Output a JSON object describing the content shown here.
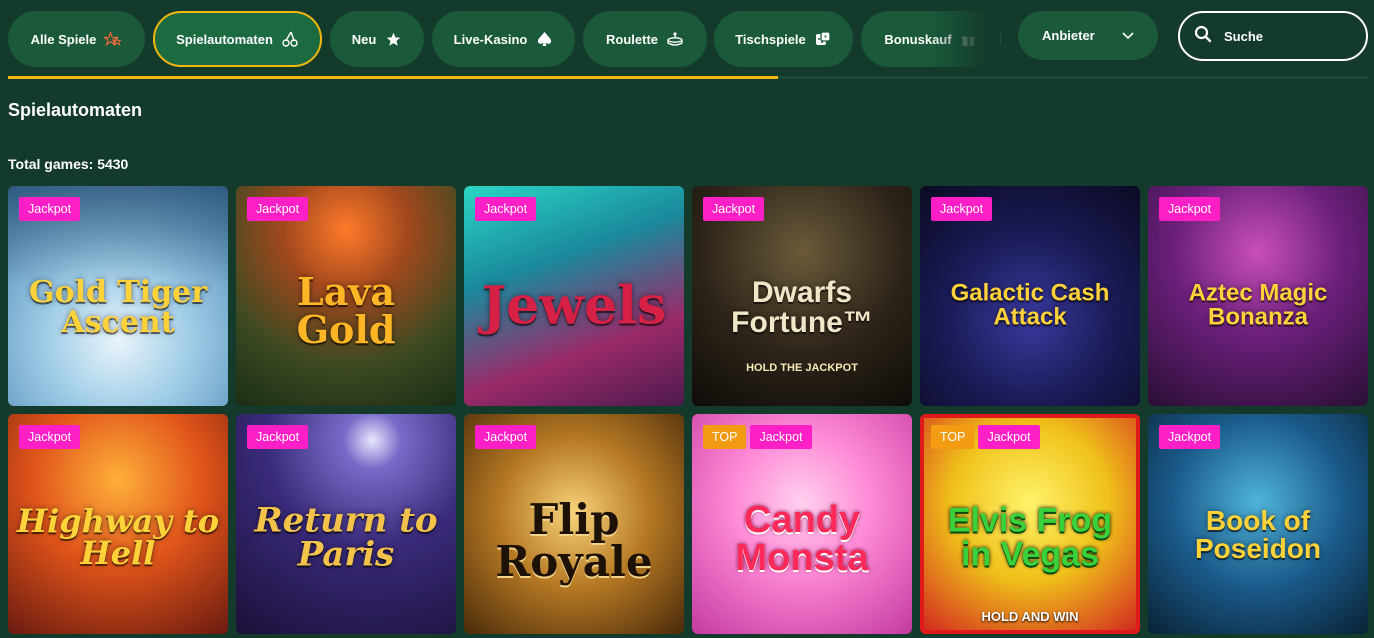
{
  "nav": {
    "tabs": [
      {
        "label": "Alle Spiele",
        "icon": "stars-icon",
        "active": false
      },
      {
        "label": "Spielautomaten",
        "icon": "cherries-icon",
        "active": true
      },
      {
        "label": "Neu",
        "icon": "star-icon",
        "active": false
      },
      {
        "label": "Live-Kasino",
        "icon": "spade-icon",
        "active": false
      },
      {
        "label": "Roulette",
        "icon": "roulette-icon",
        "active": false
      },
      {
        "label": "Tischspiele",
        "icon": "dice-icon",
        "active": false
      },
      {
        "label": "Bonuskauf",
        "icon": "gift-icon",
        "active": false
      }
    ],
    "provider_dropdown": {
      "label": "Anbieter"
    },
    "search": {
      "placeholder": "Suche"
    }
  },
  "scroll_progress_percent": 56.6,
  "section": {
    "title": "Spielautomaten",
    "total_label": "Total games: 5430"
  },
  "colors": {
    "background": "#133a2a",
    "chip": "#1a5a3b",
    "accent": "#f3b70f",
    "badge_jackpot": "#ff1fc6",
    "badge_top": "#f29b13"
  },
  "games": [
    {
      "name": "Gold Tiger Ascent",
      "badges": [
        "Jackpot"
      ]
    },
    {
      "name": "Lava Gold",
      "badges": [
        "Jackpot"
      ]
    },
    {
      "name": "Jewels",
      "badges": [
        "Jackpot"
      ]
    },
    {
      "name": "Dwarfs Fortune™",
      "subtitle": "HOLD THE JACKPOT",
      "badges": [
        "Jackpot"
      ]
    },
    {
      "name": "Galactic Cash Attack",
      "badges": [
        "Jackpot"
      ]
    },
    {
      "name": "Aztec Magic Bonanza",
      "badges": [
        "Jackpot"
      ]
    },
    {
      "name": "Highway to Hell",
      "badges": [
        "Jackpot"
      ]
    },
    {
      "name": "Return to Paris",
      "badges": [
        "Jackpot"
      ]
    },
    {
      "name": "Flip Royale",
      "badges": [
        "Jackpot"
      ]
    },
    {
      "name": "Candy Monsta",
      "badges": [
        "TOP",
        "Jackpot"
      ]
    },
    {
      "name": "Elvis Frog in Vegas",
      "subtitle": "HOLD AND WIN",
      "badges": [
        "TOP",
        "Jackpot"
      ]
    },
    {
      "name": "Book of Poseidon",
      "badges": [
        "Jackpot"
      ]
    }
  ]
}
